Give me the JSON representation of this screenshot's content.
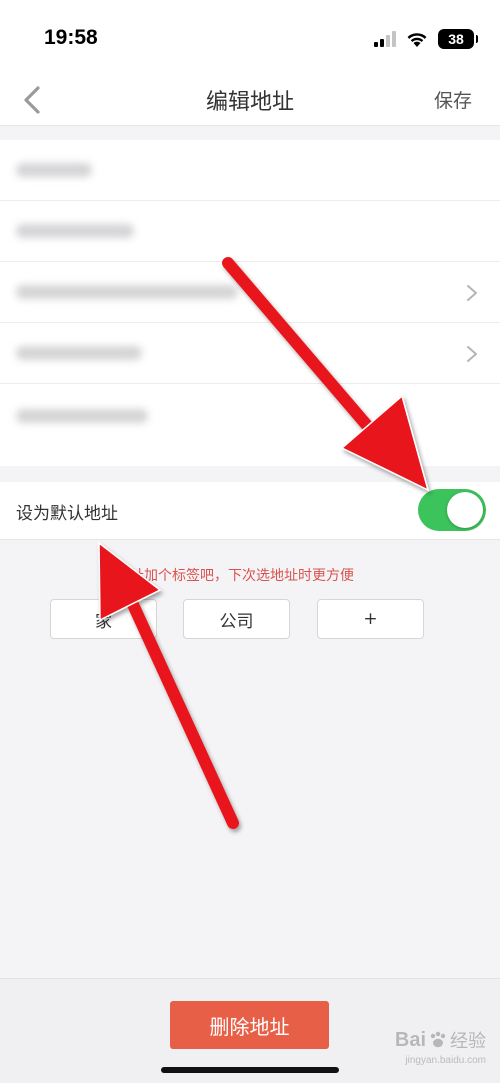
{
  "status_bar": {
    "time": "19:58",
    "battery": "38",
    "icons": [
      "cellular-signal-icon",
      "wifi-icon",
      "battery-icon"
    ]
  },
  "nav": {
    "back_icon": "chevron-left-icon",
    "title": "编辑地址",
    "save_label": "保存"
  },
  "form": {
    "rows": [
      {
        "content": "blurred",
        "has_chevron": false
      },
      {
        "content": "blurred",
        "has_chevron": false
      },
      {
        "content": "blurred",
        "has_chevron": true
      },
      {
        "content": "blurred",
        "has_chevron": true
      },
      {
        "content": "blurred",
        "has_chevron": false
      }
    ]
  },
  "default_address": {
    "label": "设为默认地址",
    "enabled": true
  },
  "tags": {
    "hint": "地址加个标签吧，下次选地址时更方便",
    "items": [
      "家",
      "公司",
      "+"
    ]
  },
  "footer": {
    "delete_label": "删除地址"
  },
  "watermark": {
    "logo": "Bai",
    "text": "经验",
    "sub": "jingyan.baidu.com"
  },
  "colors": {
    "accent_green": "#3cc35c",
    "delete_red": "#e85f47",
    "hint_red": "#d9534f",
    "annotation_arrow": "#e8151b"
  }
}
